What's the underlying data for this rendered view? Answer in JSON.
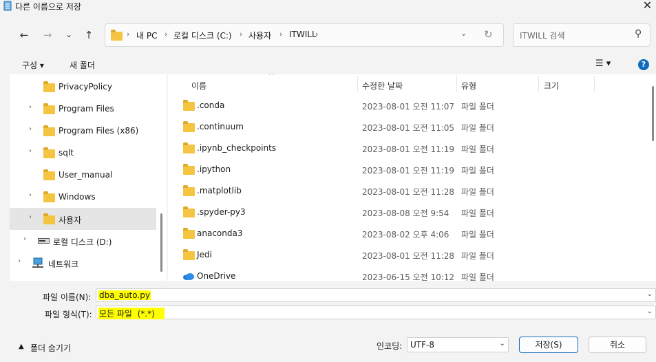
{
  "window": {
    "title": "다른 이름으로 저장",
    "close_glyph": "✕"
  },
  "nav": {
    "back_glyph": "←",
    "forward_glyph": "→",
    "recent_glyph": "⌄",
    "up_glyph": "↑",
    "breadcrumb": [
      "내 PC",
      "로컬 디스크 (C:)",
      "사용자",
      "ITWILL"
    ],
    "refresh_glyph": "↻",
    "search_placeholder": "ITWILL 검색",
    "search_glyph": "⚲"
  },
  "toolbar": {
    "organize_label": "구성 ▾",
    "new_folder_label": "새 폴더",
    "view_glyph": "☰ ▾",
    "help_glyph": "?"
  },
  "tree": [
    {
      "label": "PrivacyPolicy",
      "expandable": false,
      "icon": "folder-icon"
    },
    {
      "label": "Program Files",
      "expandable": true,
      "icon": "folder-icon"
    },
    {
      "label": "Program Files (x86)",
      "expandable": true,
      "icon": "folder-icon"
    },
    {
      "label": "sqlt",
      "expandable": true,
      "icon": "folder-icon"
    },
    {
      "label": "User_manual",
      "expandable": false,
      "icon": "folder-icon"
    },
    {
      "label": "Windows",
      "expandable": true,
      "icon": "folder-icon"
    },
    {
      "label": "사용자",
      "expandable": true,
      "icon": "folder-icon",
      "selected": true
    },
    {
      "label": "로컬 디스크 (D:)",
      "expandable": true,
      "icon": "drive-icon"
    },
    {
      "label": "네트워크",
      "expandable": true,
      "icon": "network-icon"
    }
  ],
  "columns": {
    "name": "이름",
    "modified": "수정한 날짜",
    "type": "유형",
    "size": "크기"
  },
  "files": [
    {
      "name": ".conda",
      "modified": "2023-08-01 오전 11:07",
      "type": "파일 폴더",
      "icon": "folder-icon"
    },
    {
      "name": ".continuum",
      "modified": "2023-08-01 오전 11:05",
      "type": "파일 폴더",
      "icon": "folder-icon"
    },
    {
      "name": ".ipynb_checkpoints",
      "modified": "2023-08-01 오전 11:19",
      "type": "파일 폴더",
      "icon": "folder-icon"
    },
    {
      "name": ".ipython",
      "modified": "2023-08-01 오전 11:19",
      "type": "파일 폴더",
      "icon": "folder-icon"
    },
    {
      "name": ".matplotlib",
      "modified": "2023-08-01 오전 11:28",
      "type": "파일 폴더",
      "icon": "folder-icon"
    },
    {
      "name": ".spyder-py3",
      "modified": "2023-08-08 오전 9:54",
      "type": "파일 폴더",
      "icon": "folder-icon"
    },
    {
      "name": "anaconda3",
      "modified": "2023-08-02 오후 4:06",
      "type": "파일 폴더",
      "icon": "folder-icon"
    },
    {
      "name": "Jedi",
      "modified": "2023-08-01 오전 11:28",
      "type": "파일 폴더",
      "icon": "folder-icon"
    },
    {
      "name": "OneDrive",
      "modified": "2023-06-15 오전 10:12",
      "type": "파일 폴더",
      "icon": "onedrive-icon"
    }
  ],
  "save": {
    "filename_label": "파일 이름(N):",
    "filename_value": "dba_auto.py",
    "filetype_label": "파일 형식(T):",
    "filetype_value": "모든 파일  (*.*)",
    "hide_folders_label": "폴더 숨기기",
    "encoding_label": "인코딩:",
    "encoding_value": "UTF-8",
    "save_button": "저장(S)",
    "cancel_button": "취소"
  },
  "colors": {
    "highlight": "#ffff00",
    "selected_row": "#e5e5e5",
    "folder": "#f5c542",
    "help": "#0f6cbd"
  }
}
